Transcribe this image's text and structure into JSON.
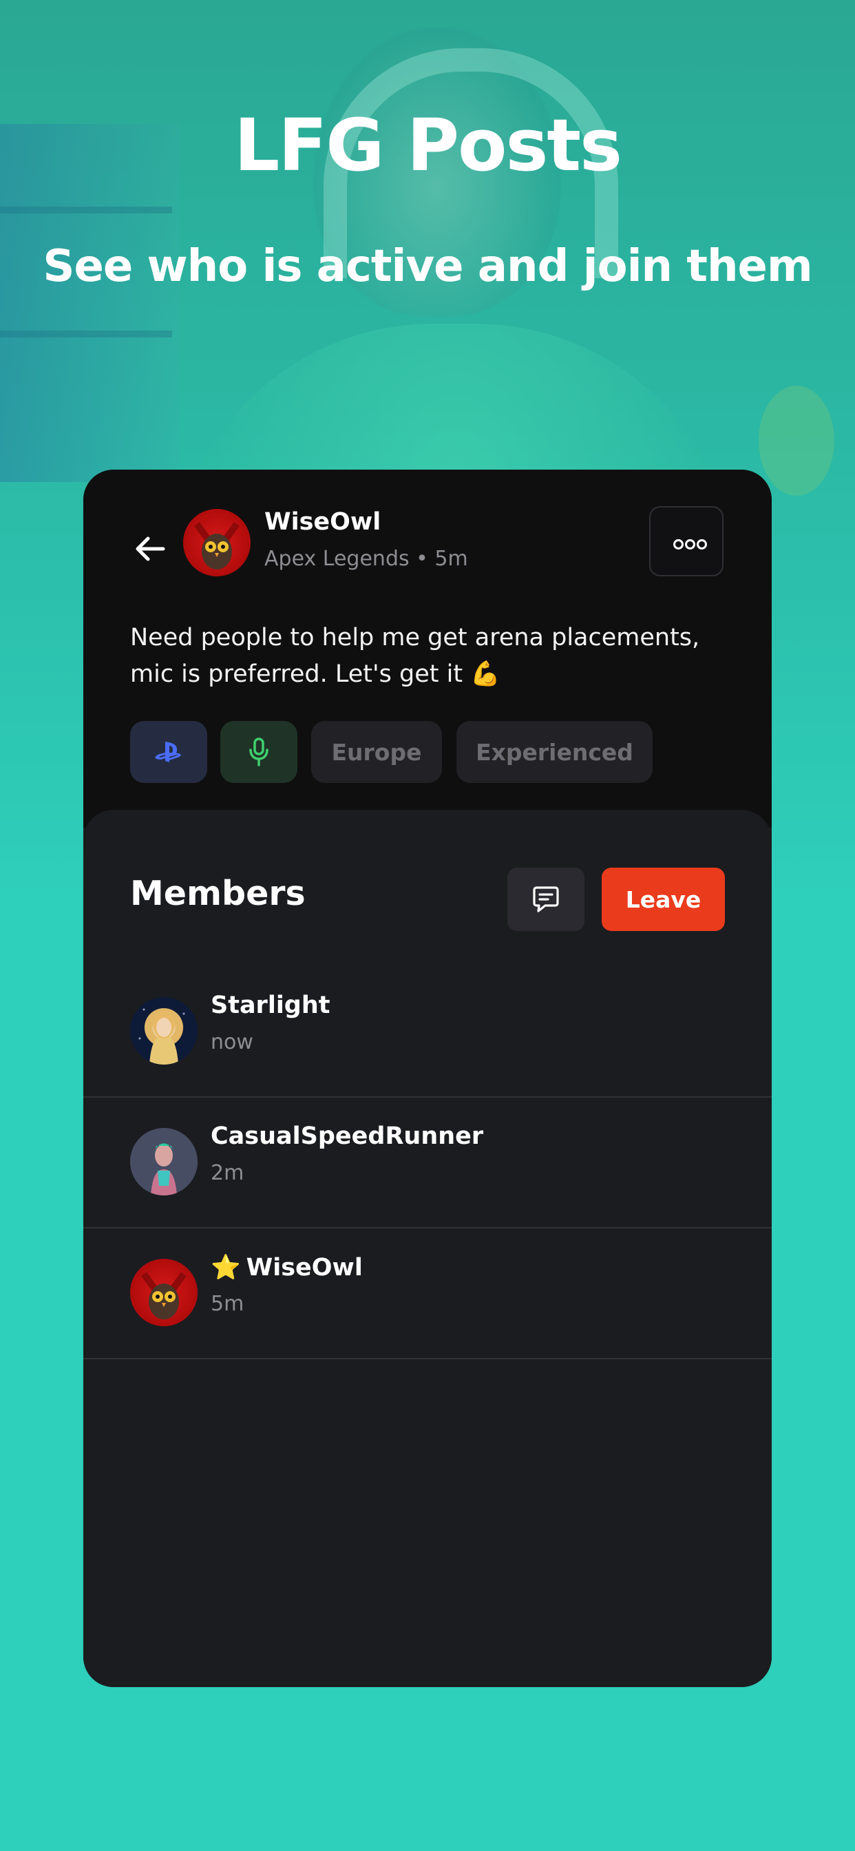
{
  "hero": {
    "title": "LFG Posts",
    "subtitle": "See who is active and join them"
  },
  "post": {
    "back_icon": "arrow-left-icon",
    "author": {
      "name": "WiseOwl",
      "meta": "Apex Legends • 5m",
      "avatar_icon": "owl-avatar"
    },
    "more_icon": "more-horizontal-icon",
    "text": "Need people to help me get arena placements, mic is preferred. Let's get it 💪",
    "tags": [
      {
        "type": "platform",
        "icon": "playstation-icon",
        "color": "#4a6cf7"
      },
      {
        "type": "voice",
        "icon": "microphone-icon",
        "color": "#3fcf6e"
      },
      {
        "label": "Europe"
      },
      {
        "label": "Experienced"
      }
    ]
  },
  "members": {
    "title": "Members",
    "chat_icon": "chat-icon",
    "leave_label": "Leave",
    "list": [
      {
        "name": "Starlight",
        "time": "now",
        "avatar_icon": "starlight-avatar"
      },
      {
        "name": "CasualSpeedRunner",
        "time": "2m",
        "avatar_icon": "runner-avatar"
      },
      {
        "name": "WiseOwl",
        "time": "5m",
        "avatar_icon": "owl-avatar",
        "badge_icon": "star-icon",
        "badge": "⭐"
      }
    ]
  },
  "colors": {
    "accent": "#ea3b1c",
    "background": "#2ecfbb",
    "card": "#1b1c20"
  }
}
